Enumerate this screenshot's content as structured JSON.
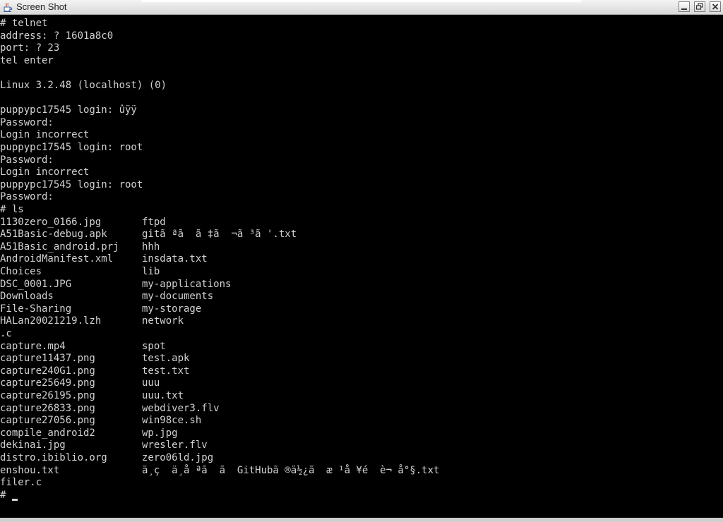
{
  "window": {
    "title": "Screen Shot",
    "app_icon": "java-coffee-cup-icon",
    "controls": {
      "minimize_icon": "minimize-icon",
      "restore_icon": "restore-icon",
      "close_icon": "close-icon"
    }
  },
  "terminal": {
    "lines": [
      "# telnet",
      "address: ? 1601a8c0",
      "port: ? 23",
      "tel enter",
      "",
      "Linux 3.2.48 (localhost) (0)",
      "",
      "puppypc17545 login: ûÿÿ",
      "Password:",
      "Login incorrect",
      "puppypc17545 login: root",
      "Password:",
      "Login incorrect",
      "puppypc17545 login: root",
      "Password:",
      "# ls"
    ],
    "ls_rows": [
      [
        "1130zero_0166.jpg",
        "ftpd"
      ],
      [
        "A51Basic-debug.apk",
        "gitã ªã  ã ‡ã  ¬ã ³ã '.txt"
      ],
      [
        "A51Basic_android.prj",
        "hhh"
      ],
      [
        "AndroidManifest.xml",
        "insdata.txt"
      ],
      [
        "Choices",
        "lib"
      ],
      [
        "DSC_0001.JPG",
        "my-applications"
      ],
      [
        "Downloads",
        "my-documents"
      ],
      [
        "File-Sharing",
        "my-storage"
      ],
      [
        "HALan20021219.lzh",
        "network"
      ],
      [
        ".c",
        ""
      ],
      [
        "capture.mp4",
        "spot"
      ],
      [
        "capture11437.png",
        "test.apk"
      ],
      [
        "capture240G1.png",
        "test.txt"
      ],
      [
        "capture25649.png",
        "uuu"
      ],
      [
        "capture26195.png",
        "uuu.txt"
      ],
      [
        "capture26833.png",
        "webdiver3.flv"
      ],
      [
        "capture27056.png",
        "win98ce.sh"
      ],
      [
        "compile_android2",
        "wp.jpg"
      ],
      [
        "dekinai.jpg",
        "wresler.flv"
      ],
      [
        "distro.ibiblio.org",
        "zero06ld.jpg"
      ],
      [
        "enshou.txt",
        "ä¸ç  ä¸å ªã  ã  GitHubã ®ä½¿ã  æ ¹å ¥é  è¬ å°§.txt"
      ],
      [
        "filer.c",
        ""
      ]
    ],
    "prompt": "# "
  }
}
